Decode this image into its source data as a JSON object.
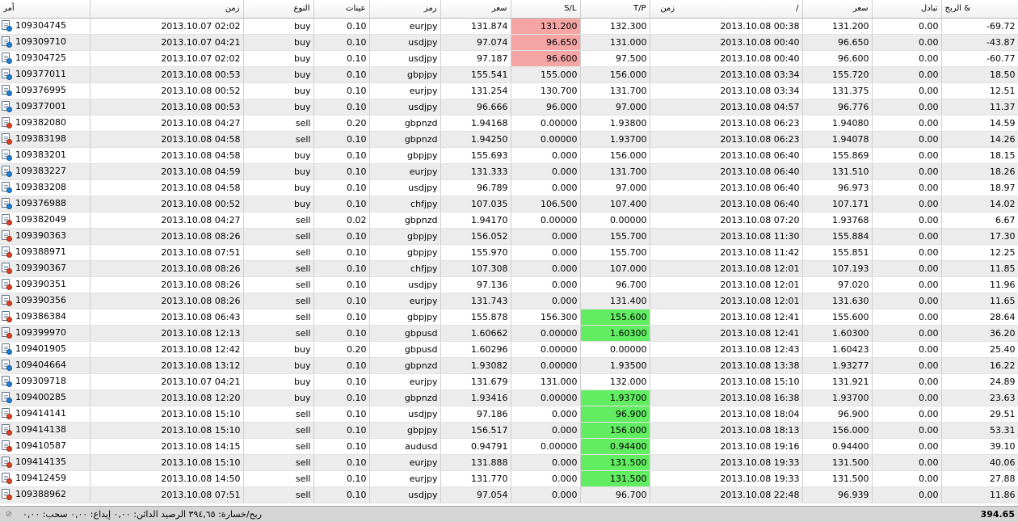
{
  "headers": [
    "أمر",
    "زمن",
    "النوع",
    "عينات",
    "رمز",
    "سعر",
    "S/L",
    "T/P",
    "زمن",
    "سعر",
    "تبادل",
    "الربح &"
  ],
  "header_close_marker": "/",
  "colors": {
    "sl_hit": "#f6a5a5",
    "tp_hit": "#62ec62",
    "buy_icon": "#1e7fd6",
    "sell_icon": "#e0401f"
  },
  "rows": [
    {
      "order": "109304745",
      "open_time": "2013.10.07 02:02",
      "type": "buy",
      "size": "0.10",
      "symbol": "eurjpy",
      "open_price": "131.874",
      "sl": "131.200",
      "tp": "132.300",
      "close_time": "2013.10.08 00:38",
      "close_price": "131.200",
      "swap": "0.00",
      "profit": "-69.72",
      "hl": "sl"
    },
    {
      "order": "109309710",
      "open_time": "2013.10.07 04:21",
      "type": "buy",
      "size": "0.10",
      "symbol": "usdjpy",
      "open_price": "97.074",
      "sl": "96.650",
      "tp": "131.000",
      "close_time": "2013.10.08 00:40",
      "close_price": "96.650",
      "swap": "0.00",
      "profit": "-43.87",
      "hl": "sl"
    },
    {
      "order": "109304725",
      "open_time": "2013.10.07 02:02",
      "type": "buy",
      "size": "0.10",
      "symbol": "usdjpy",
      "open_price": "97.187",
      "sl": "96.600",
      "tp": "97.500",
      "close_time": "2013.10.08 00:40",
      "close_price": "96.600",
      "swap": "0.00",
      "profit": "-60.77",
      "hl": "sl"
    },
    {
      "order": "109377011",
      "open_time": "2013.10.08 00:53",
      "type": "buy",
      "size": "0.10",
      "symbol": "gbpjpy",
      "open_price": "155.541",
      "sl": "155.000",
      "tp": "156.000",
      "close_time": "2013.10.08 03:34",
      "close_price": "155.720",
      "swap": "0.00",
      "profit": "18.50",
      "hl": ""
    },
    {
      "order": "109376995",
      "open_time": "2013.10.08 00:52",
      "type": "buy",
      "size": "0.10",
      "symbol": "eurjpy",
      "open_price": "131.254",
      "sl": "130.700",
      "tp": "131.700",
      "close_time": "2013.10.08 03:34",
      "close_price": "131.375",
      "swap": "0.00",
      "profit": "12.51",
      "hl": ""
    },
    {
      "order": "109377001",
      "open_time": "2013.10.08 00:53",
      "type": "buy",
      "size": "0.10",
      "symbol": "usdjpy",
      "open_price": "96.666",
      "sl": "96.000",
      "tp": "97.000",
      "close_time": "2013.10.08 04:57",
      "close_price": "96.776",
      "swap": "0.00",
      "profit": "11.37",
      "hl": ""
    },
    {
      "order": "109382080",
      "open_time": "2013.10.08 04:27",
      "type": "sell",
      "size": "0.20",
      "symbol": "gbpnzd",
      "open_price": "1.94168",
      "sl": "0.00000",
      "tp": "1.93800",
      "close_time": "2013.10.08 06:23",
      "close_price": "1.94080",
      "swap": "0.00",
      "profit": "14.59",
      "hl": ""
    },
    {
      "order": "109383198",
      "open_time": "2013.10.08 04:58",
      "type": "sell",
      "size": "0.10",
      "symbol": "gbpnzd",
      "open_price": "1.94250",
      "sl": "0.00000",
      "tp": "1.93700",
      "close_time": "2013.10.08 06:23",
      "close_price": "1.94078",
      "swap": "0.00",
      "profit": "14.26",
      "hl": ""
    },
    {
      "order": "109383201",
      "open_time": "2013.10.08 04:58",
      "type": "buy",
      "size": "0.10",
      "symbol": "gbpjpy",
      "open_price": "155.693",
      "sl": "0.000",
      "tp": "156.000",
      "close_time": "2013.10.08 06:40",
      "close_price": "155.869",
      "swap": "0.00",
      "profit": "18.15",
      "hl": ""
    },
    {
      "order": "109383227",
      "open_time": "2013.10.08 04:59",
      "type": "buy",
      "size": "0.10",
      "symbol": "eurjpy",
      "open_price": "131.333",
      "sl": "0.000",
      "tp": "131.700",
      "close_time": "2013.10.08 06:40",
      "close_price": "131.510",
      "swap": "0.00",
      "profit": "18.26",
      "hl": ""
    },
    {
      "order": "109383208",
      "open_time": "2013.10.08 04:58",
      "type": "buy",
      "size": "0.10",
      "symbol": "usdjpy",
      "open_price": "96.789",
      "sl": "0.000",
      "tp": "97.000",
      "close_time": "2013.10.08 06:40",
      "close_price": "96.973",
      "swap": "0.00",
      "profit": "18.97",
      "hl": ""
    },
    {
      "order": "109376988",
      "open_time": "2013.10.08 00:52",
      "type": "buy",
      "size": "0.10",
      "symbol": "chfjpy",
      "open_price": "107.035",
      "sl": "106.500",
      "tp": "107.400",
      "close_time": "2013.10.08 06:40",
      "close_price": "107.171",
      "swap": "0.00",
      "profit": "14.02",
      "hl": ""
    },
    {
      "order": "109382049",
      "open_time": "2013.10.08 04:27",
      "type": "sell",
      "size": "0.02",
      "symbol": "gbpnzd",
      "open_price": "1.94170",
      "sl": "0.00000",
      "tp": "0.00000",
      "close_time": "2013.10.08 07:20",
      "close_price": "1.93768",
      "swap": "0.00",
      "profit": "6.67",
      "hl": ""
    },
    {
      "order": "109390363",
      "open_time": "2013.10.08 08:26",
      "type": "sell",
      "size": "0.10",
      "symbol": "gbpjpy",
      "open_price": "156.052",
      "sl": "0.000",
      "tp": "155.700",
      "close_time": "2013.10.08 11:30",
      "close_price": "155.884",
      "swap": "0.00",
      "profit": "17.30",
      "hl": ""
    },
    {
      "order": "109388971",
      "open_time": "2013.10.08 07:51",
      "type": "sell",
      "size": "0.10",
      "symbol": "gbpjpy",
      "open_price": "155.970",
      "sl": "0.000",
      "tp": "155.700",
      "close_time": "2013.10.08 11:42",
      "close_price": "155.851",
      "swap": "0.00",
      "profit": "12.25",
      "hl": ""
    },
    {
      "order": "109390367",
      "open_time": "2013.10.08 08:26",
      "type": "sell",
      "size": "0.10",
      "symbol": "chfjpy",
      "open_price": "107.308",
      "sl": "0.000",
      "tp": "107.000",
      "close_time": "2013.10.08 12:01",
      "close_price": "107.193",
      "swap": "0.00",
      "profit": "11.85",
      "hl": ""
    },
    {
      "order": "109390351",
      "open_time": "2013.10.08 08:26",
      "type": "sell",
      "size": "0.10",
      "symbol": "usdjpy",
      "open_price": "97.136",
      "sl": "0.000",
      "tp": "96.700",
      "close_time": "2013.10.08 12:01",
      "close_price": "97.020",
      "swap": "0.00",
      "profit": "11.96",
      "hl": ""
    },
    {
      "order": "109390356",
      "open_time": "2013.10.08 08:26",
      "type": "sell",
      "size": "0.10",
      "symbol": "eurjpy",
      "open_price": "131.743",
      "sl": "0.000",
      "tp": "131.400",
      "close_time": "2013.10.08 12:01",
      "close_price": "131.630",
      "swap": "0.00",
      "profit": "11.65",
      "hl": ""
    },
    {
      "order": "109386384",
      "open_time": "2013.10.08 06:43",
      "type": "sell",
      "size": "0.10",
      "symbol": "gbpjpy",
      "open_price": "155.878",
      "sl": "156.300",
      "tp": "155.600",
      "close_time": "2013.10.08 12:41",
      "close_price": "155.600",
      "swap": "0.00",
      "profit": "28.64",
      "hl": "tp"
    },
    {
      "order": "109399970",
      "open_time": "2013.10.08 12:13",
      "type": "sell",
      "size": "0.10",
      "symbol": "gbpusd",
      "open_price": "1.60662",
      "sl": "0.00000",
      "tp": "1.60300",
      "close_time": "2013.10.08 12:41",
      "close_price": "1.60300",
      "swap": "0.00",
      "profit": "36.20",
      "hl": "tp"
    },
    {
      "order": "109401905",
      "open_time": "2013.10.08 12:42",
      "type": "buy",
      "size": "0.20",
      "symbol": "gbpusd",
      "open_price": "1.60296",
      "sl": "0.00000",
      "tp": "0.00000",
      "close_time": "2013.10.08 12:43",
      "close_price": "1.60423",
      "swap": "0.00",
      "profit": "25.40",
      "hl": ""
    },
    {
      "order": "109404664",
      "open_time": "2013.10.08 13:12",
      "type": "buy",
      "size": "0.10",
      "symbol": "gbpnzd",
      "open_price": "1.93082",
      "sl": "0.00000",
      "tp": "1.93500",
      "close_time": "2013.10.08 13:38",
      "close_price": "1.93277",
      "swap": "0.00",
      "profit": "16.22",
      "hl": ""
    },
    {
      "order": "109309718",
      "open_time": "2013.10.07 04:21",
      "type": "buy",
      "size": "0.10",
      "symbol": "eurjpy",
      "open_price": "131.679",
      "sl": "131.000",
      "tp": "132.000",
      "close_time": "2013.10.08 15:10",
      "close_price": "131.921",
      "swap": "0.00",
      "profit": "24.89",
      "hl": ""
    },
    {
      "order": "109400285",
      "open_time": "2013.10.08 12:20",
      "type": "buy",
      "size": "0.10",
      "symbol": "gbpnzd",
      "open_price": "1.93416",
      "sl": "0.00000",
      "tp": "1.93700",
      "close_time": "2013.10.08 16:38",
      "close_price": "1.93700",
      "swap": "0.00",
      "profit": "23.63",
      "hl": "tp"
    },
    {
      "order": "109414141",
      "open_time": "2013.10.08 15:10",
      "type": "sell",
      "size": "0.10",
      "symbol": "usdjpy",
      "open_price": "97.186",
      "sl": "0.000",
      "tp": "96.900",
      "close_time": "2013.10.08 18:04",
      "close_price": "96.900",
      "swap": "0.00",
      "profit": "29.51",
      "hl": "tp"
    },
    {
      "order": "109414138",
      "open_time": "2013.10.08 15:10",
      "type": "sell",
      "size": "0.10",
      "symbol": "gbpjpy",
      "open_price": "156.517",
      "sl": "0.000",
      "tp": "156.000",
      "close_time": "2013.10.08 18:13",
      "close_price": "156.000",
      "swap": "0.00",
      "profit": "53.31",
      "hl": "tp"
    },
    {
      "order": "109410587",
      "open_time": "2013.10.08 14:15",
      "type": "sell",
      "size": "0.10",
      "symbol": "audusd",
      "open_price": "0.94791",
      "sl": "0.00000",
      "tp": "0.94400",
      "close_time": "2013.10.08 19:16",
      "close_price": "0.94400",
      "swap": "0.00",
      "profit": "39.10",
      "hl": "tp"
    },
    {
      "order": "109414135",
      "open_time": "2013.10.08 15:10",
      "type": "sell",
      "size": "0.10",
      "symbol": "eurjpy",
      "open_price": "131.888",
      "sl": "0.000",
      "tp": "131.500",
      "close_time": "2013.10.08 19:33",
      "close_price": "131.500",
      "swap": "0.00",
      "profit": "40.06",
      "hl": "tp"
    },
    {
      "order": "109412459",
      "open_time": "2013.10.08 14:50",
      "type": "sell",
      "size": "0.10",
      "symbol": "eurjpy",
      "open_price": "131.770",
      "sl": "0.000",
      "tp": "131.500",
      "close_time": "2013.10.08 19:33",
      "close_price": "131.500",
      "swap": "0.00",
      "profit": "27.88",
      "hl": "tp"
    },
    {
      "order": "109388962",
      "open_time": "2013.10.08 07:51",
      "type": "sell",
      "size": "0.10",
      "symbol": "usdjpy",
      "open_price": "97.054",
      "sl": "0.000",
      "tp": "96.700",
      "close_time": "2013.10.08 22:48",
      "close_price": "96.939",
      "swap": "0.00",
      "profit": "11.86",
      "hl": ""
    }
  ],
  "status": {
    "summary": "ربح/خسارة: ٣٩٤,٦٥  الرصيد الدائن: ٠,٠٠  إيداع: ٠,٠٠  سحب: ٠,٠٠",
    "total": "394.65"
  }
}
